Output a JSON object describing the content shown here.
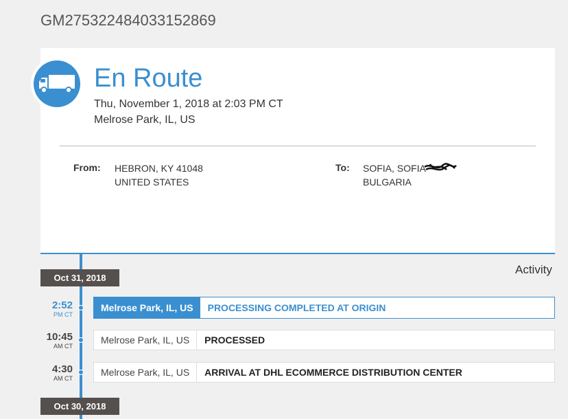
{
  "tracking_number": "GM275322484033152869",
  "status": {
    "icon": "truck-icon",
    "title": "En Route",
    "datetime": "Thu, November 1, 2018 at 2:03 PM CT",
    "location": "Melrose Park, IL, US"
  },
  "from": {
    "label": "From:",
    "line1": "HEBRON, KY 41048",
    "line2": "UNITED STATES"
  },
  "to": {
    "label": "To:",
    "line1": "SOFIA, SOFIA",
    "line2": "BULGARIA"
  },
  "activity_title": "Activity",
  "timeline": [
    {
      "date": "Oct 31, 2018",
      "events": [
        {
          "time": "2:52",
          "period": "PM CT",
          "location": "Melrose Park, IL, US",
          "description": "PROCESSING COMPLETED AT ORIGIN",
          "active": true
        },
        {
          "time": "10:45",
          "period": "AM CT",
          "location": "Melrose Park, IL, US",
          "description": "PROCESSED",
          "active": false
        },
        {
          "time": "4:30",
          "period": "AM CT",
          "location": "Melrose Park, IL, US",
          "description": "ARRIVAL AT DHL ECOMMERCE DISTRIBUTION CENTER",
          "active": false
        }
      ]
    },
    {
      "date": "Oct 30, 2018",
      "events": []
    }
  ],
  "colors": {
    "accent": "#3a8fd0",
    "badge": "#55504e",
    "background": "#f0f0f0"
  }
}
